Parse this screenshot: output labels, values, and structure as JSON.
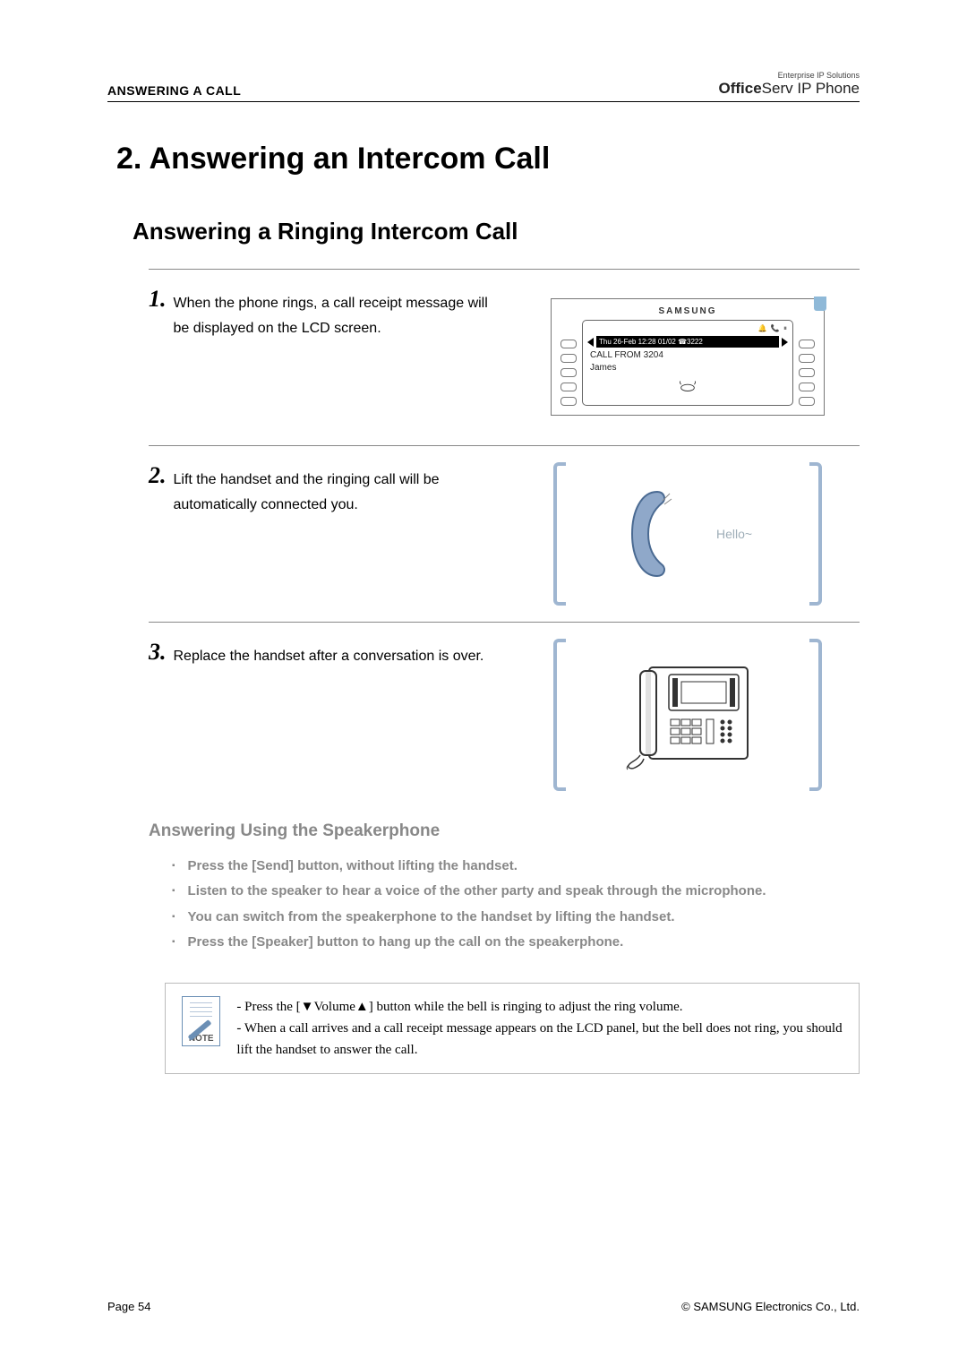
{
  "header": {
    "section": "ANSWERING A CALL",
    "brand_small": "Enterprise IP Solutions",
    "brand_bold": "Office",
    "brand_rest": "Serv IP Phone"
  },
  "title": "2. Answering an Intercom Call",
  "subtitle": "Answering a Ringing Intercom Call",
  "steps": [
    {
      "num": "1.",
      "text": "When the phone rings, a call receipt message will be displayed on the LCD screen."
    },
    {
      "num": "2.",
      "text": "Lift the handset and the ringing call will be automatically connected you."
    },
    {
      "num": "3.",
      "text": "Replace the handset after a conversation is over."
    }
  ],
  "lcd": {
    "brand": "SAMSUNG",
    "status_icons": "🔔 📞 ⏸",
    "bar": "Thu 26-Feb 12:28 01/02 ☎3222",
    "line1": "CALL FROM 3204",
    "line2": "James"
  },
  "handset": {
    "hello": "Hello~"
  },
  "speaker_section": {
    "title": "Answering Using the Speakerphone",
    "bullets": [
      "Press the [Send] button, without lifting the handset.",
      "Listen to the speaker to hear a voice of the other party and speak through the microphone.",
      "You can switch from the speakerphone to the handset by lifting the handset.",
      "Press the [Speaker] button to hang up the call on the speakerphone."
    ]
  },
  "note": {
    "label": "NOTE",
    "line1": "- Press the [▼Volume▲] button while the bell is ringing to adjust the ring volume.",
    "line2": "- When a call arrives and a call receipt message appears on the LCD panel, but the bell does not ring, you should lift the handset to answer the call."
  },
  "footer": {
    "page": "Page 54",
    "copyright": "© SAMSUNG Electronics Co., Ltd."
  }
}
